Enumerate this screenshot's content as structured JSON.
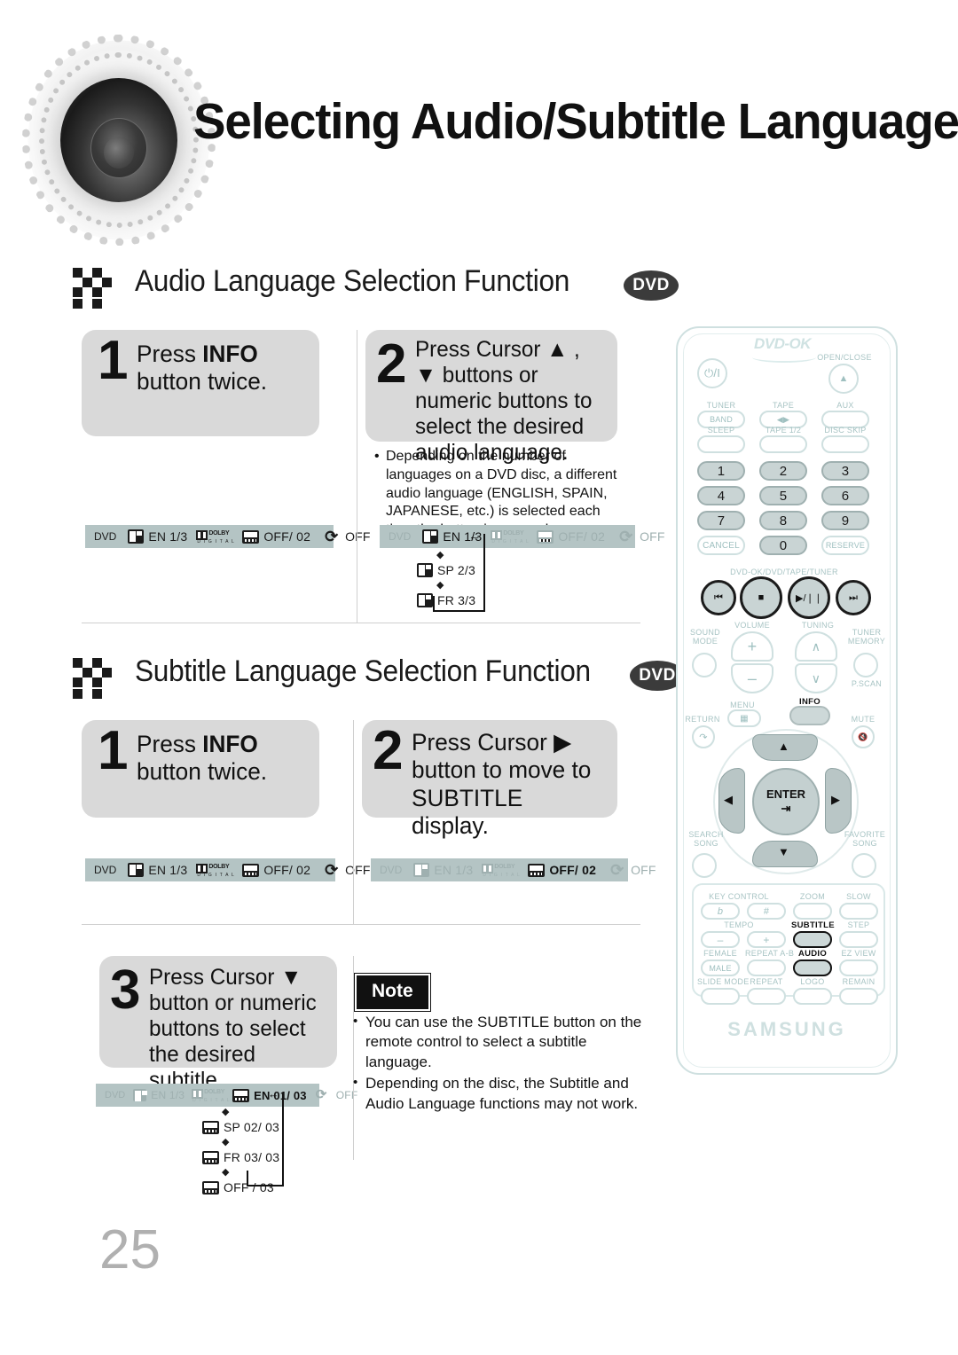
{
  "page": {
    "title": "Selecting Audio/Subtitle Language",
    "number": "25",
    "speaker_art_name": "speaker-binary-graphic"
  },
  "sections": [
    {
      "id": "audio",
      "heading": "Audio Language Selection Function",
      "badge": "DVD",
      "steps": [
        {
          "number": "1",
          "text_before": "Press ",
          "text_bold": "INFO",
          "text_after": " button twice."
        },
        {
          "number": "2",
          "text": "Press Cursor ▲ , ▼ buttons or numeric buttons to select the desired audio language."
        }
      ],
      "hint": "Depending on the number of languages on a DVD disc, a different audio language (ENGLISH, SPAIN, JAPANESE, etc.) is selected each time the button is pressed.",
      "osd_left": {
        "disc": "DVD",
        "audio": "EN 1/3",
        "dolby_top": "DOLBY",
        "dolby_bottom": "D I G I T A L",
        "subtitle": "OFF/ 02",
        "repeat": "OFF",
        "highlight": "none"
      },
      "osd_right": {
        "disc": "DVD",
        "audio": "EN 1/3",
        "dolby_top": "DOLBY",
        "dolby_bottom": "D I G I T A L",
        "subtitle": "OFF/ 02",
        "repeat": "OFF",
        "highlight": "audio"
      },
      "flow": [
        "SP 2/3",
        "FR 3/3"
      ]
    },
    {
      "id": "subtitle",
      "heading": "Subtitle Language Selection Function",
      "badge": "DVD",
      "steps": [
        {
          "number": "1",
          "text_before": "Press ",
          "text_bold": "INFO",
          "text_after": " button twice."
        },
        {
          "number": "2",
          "text": "Press Cursor ▶ button to move to SUBTITLE display."
        },
        {
          "number": "3",
          "text": "Press Cursor ▼ button or numeric buttons to select the desired subtitle."
        }
      ],
      "osd_left": {
        "disc": "DVD",
        "audio": "EN 1/3",
        "dolby_top": "DOLBY",
        "dolby_bottom": "D I G I T A L",
        "subtitle": "OFF/ 02",
        "repeat": "OFF",
        "highlight": "none"
      },
      "osd_right": {
        "disc": "DVD",
        "audio": "EN 1/3",
        "dolby_top": "DOLBY",
        "dolby_bottom": "D I G I T A L",
        "subtitle": "OFF/ 02",
        "repeat": "OFF",
        "highlight": "subtitle"
      },
      "osd_step3": {
        "disc": "DVD",
        "audio": "EN 1/3",
        "dolby_top": "DOLBY",
        "dolby_bottom": "D I G I T A L",
        "subtitle": "EN 01/ 03",
        "repeat": "OFF",
        "highlight": "subtitle"
      },
      "flow": [
        "SP 02/ 03",
        "FR 03/ 03",
        "OFF / 03"
      ]
    }
  ],
  "note": {
    "label": "Note",
    "items": [
      "You can use the SUBTITLE button on the remote control to select a subtitle language.",
      "Depending on the disc, the Subtitle and Audio Language functions may not work."
    ]
  },
  "remote": {
    "brand": "SAMSUNG",
    "logo": "DVD-OK",
    "power_label": "⏻/I",
    "open_close": "OPEN/CLOSE",
    "eject_glyph": "▲",
    "source_row": [
      {
        "label": "TUNER",
        "button": "BAND"
      },
      {
        "label": "TAPE",
        "button": "◀▶"
      },
      {
        "label": "AUX",
        "button": ""
      }
    ],
    "second_row": [
      {
        "label": "SLEEP",
        "button": ""
      },
      {
        "label": "TAPE 1/2",
        "button": ""
      },
      {
        "label": "DISC SKIP",
        "button": ""
      }
    ],
    "numbers": [
      "1",
      "2",
      "3",
      "4",
      "5",
      "6",
      "7",
      "8",
      "9"
    ],
    "cancel": "CANCEL",
    "zero": "0",
    "reserve": "RESERVE",
    "transport_label": "DVD-OK/DVD/TAPE/TUNER",
    "transport": [
      "⏮",
      "■",
      "▶/❘❘",
      "⏭"
    ],
    "volume_label": "VOLUME",
    "tuning_label": "TUNING",
    "volume_plus": "+",
    "volume_minus": "–",
    "tuning_up": "∧",
    "tuning_down": "∨",
    "sound_mode": "SOUND\nMODE",
    "tuner_memory": "TUNER\nMEMORY",
    "p_scan": "P.SCAN",
    "menu": "MENU",
    "info": "INFO",
    "return": "RETURN",
    "mute": "MUTE",
    "enter": "ENTER",
    "search_song": "SEARCH\nSONG",
    "favorite_song": "FAVORITE\nSONG",
    "key_control": "KEY CONTROL",
    "key_flat": "b",
    "key_sharp": "#",
    "zoom": "ZOOM",
    "slow": "SLOW",
    "tempo": "TEMPO",
    "tempo_minus": "–",
    "tempo_plus": "+",
    "subtitle": "SUBTITLE",
    "step": "STEP",
    "female": "FEMALE",
    "male": "MALE",
    "repeat_ab": "REPEAT A-B",
    "audio": "AUDIO",
    "ez_view": "EZ VIEW",
    "slide_mode": "SLIDE MODE",
    "repeat": "REPEAT",
    "logo_btn": "LOGO",
    "remain": "REMAIN"
  },
  "colors": {
    "osd_bar": "#b4c4c4",
    "step_box": "#d9d9d9",
    "badge": "#3b3b3b",
    "remote_trim": "#cfe0e0",
    "page_number": "#b0b0b0"
  }
}
